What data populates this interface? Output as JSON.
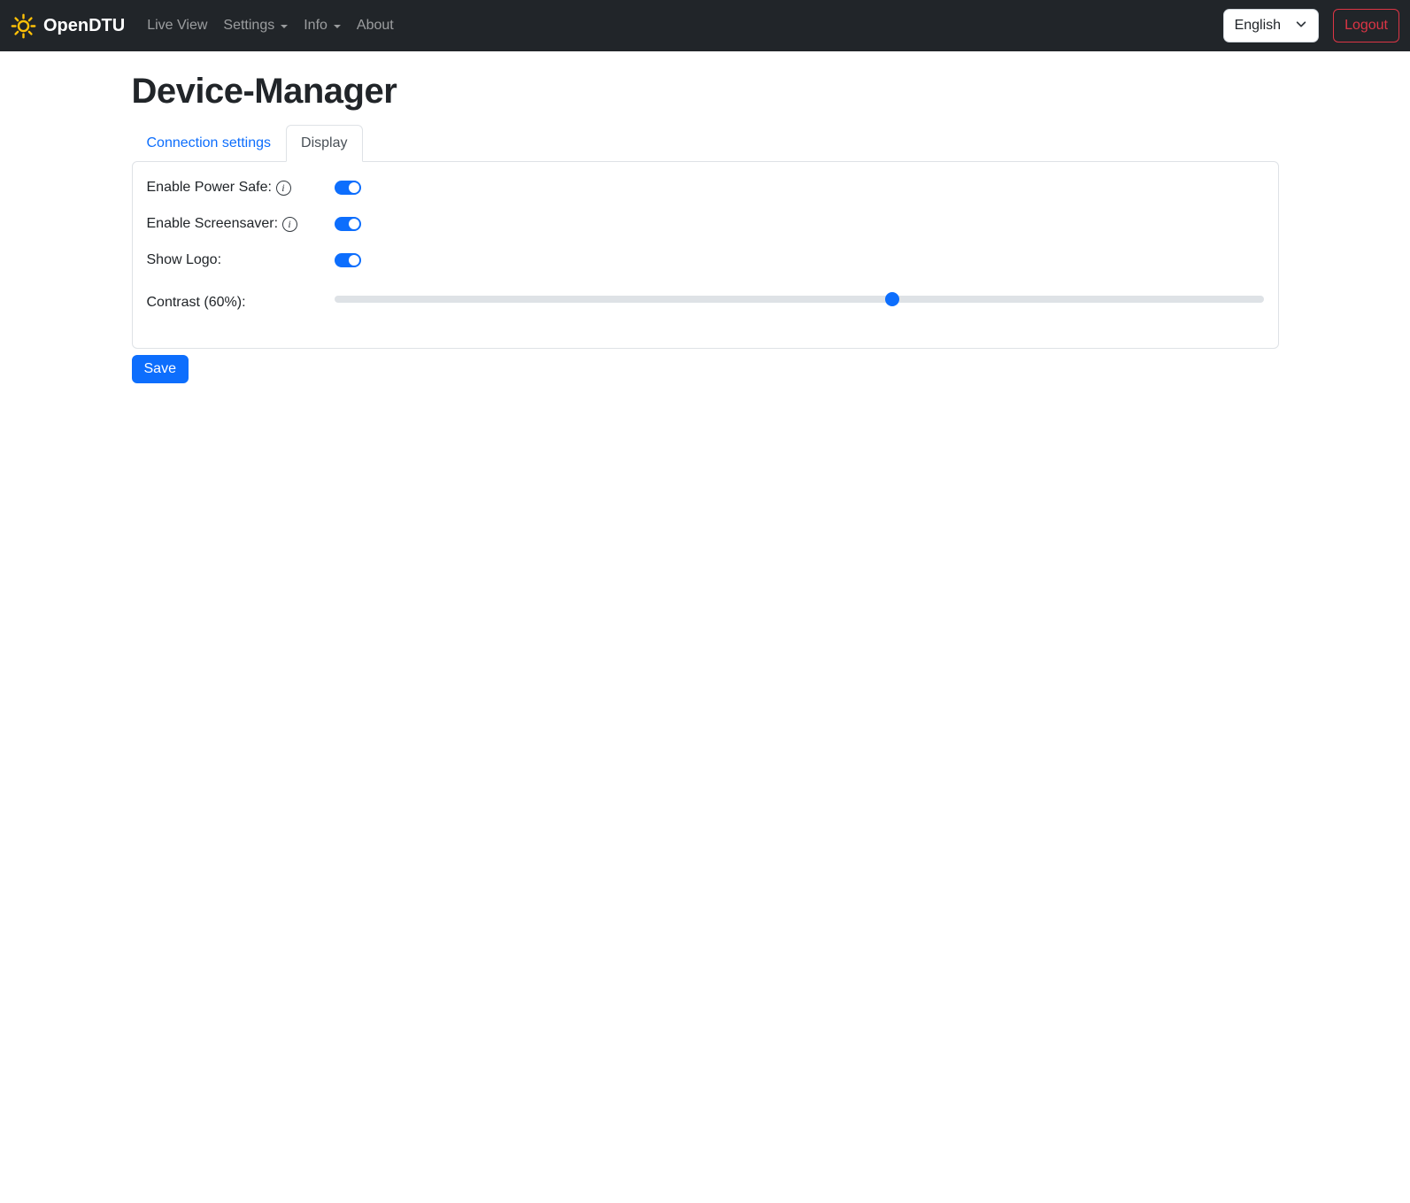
{
  "navbar": {
    "brand": "OpenDTU",
    "links": [
      {
        "label": "Live View",
        "dropdown": false
      },
      {
        "label": "Settings",
        "dropdown": true
      },
      {
        "label": "Info",
        "dropdown": true
      },
      {
        "label": "About",
        "dropdown": false
      }
    ],
    "language_selector": {
      "value": "English"
    },
    "logout_label": "Logout"
  },
  "page": {
    "title": "Device-Manager"
  },
  "tabs": [
    {
      "label": "Connection settings",
      "active": false
    },
    {
      "label": "Display",
      "active": true
    }
  ],
  "form": {
    "rows": [
      {
        "label": "Enable Power Safe:",
        "type": "switch",
        "value": true,
        "has_info": true
      },
      {
        "label": "Enable Screensaver:",
        "type": "switch",
        "value": true,
        "has_info": true
      },
      {
        "label": "Show Logo:",
        "type": "switch",
        "value": true,
        "has_info": false
      },
      {
        "label": "Contrast (60%):",
        "type": "range",
        "value": 60,
        "min": 0,
        "max": 100
      }
    ],
    "save_label": "Save"
  },
  "icons": {
    "brand": "sun-icon",
    "nav_dropdown": "caret-down-icon",
    "language": "chevron-down-icon",
    "row_help": "info-circle-icon"
  },
  "colors": {
    "accent": "#0d6efd",
    "navbar_bg": "#212529",
    "danger": "#dc3545",
    "brand_icon": "#ffc107",
    "border": "#dee2e6"
  }
}
